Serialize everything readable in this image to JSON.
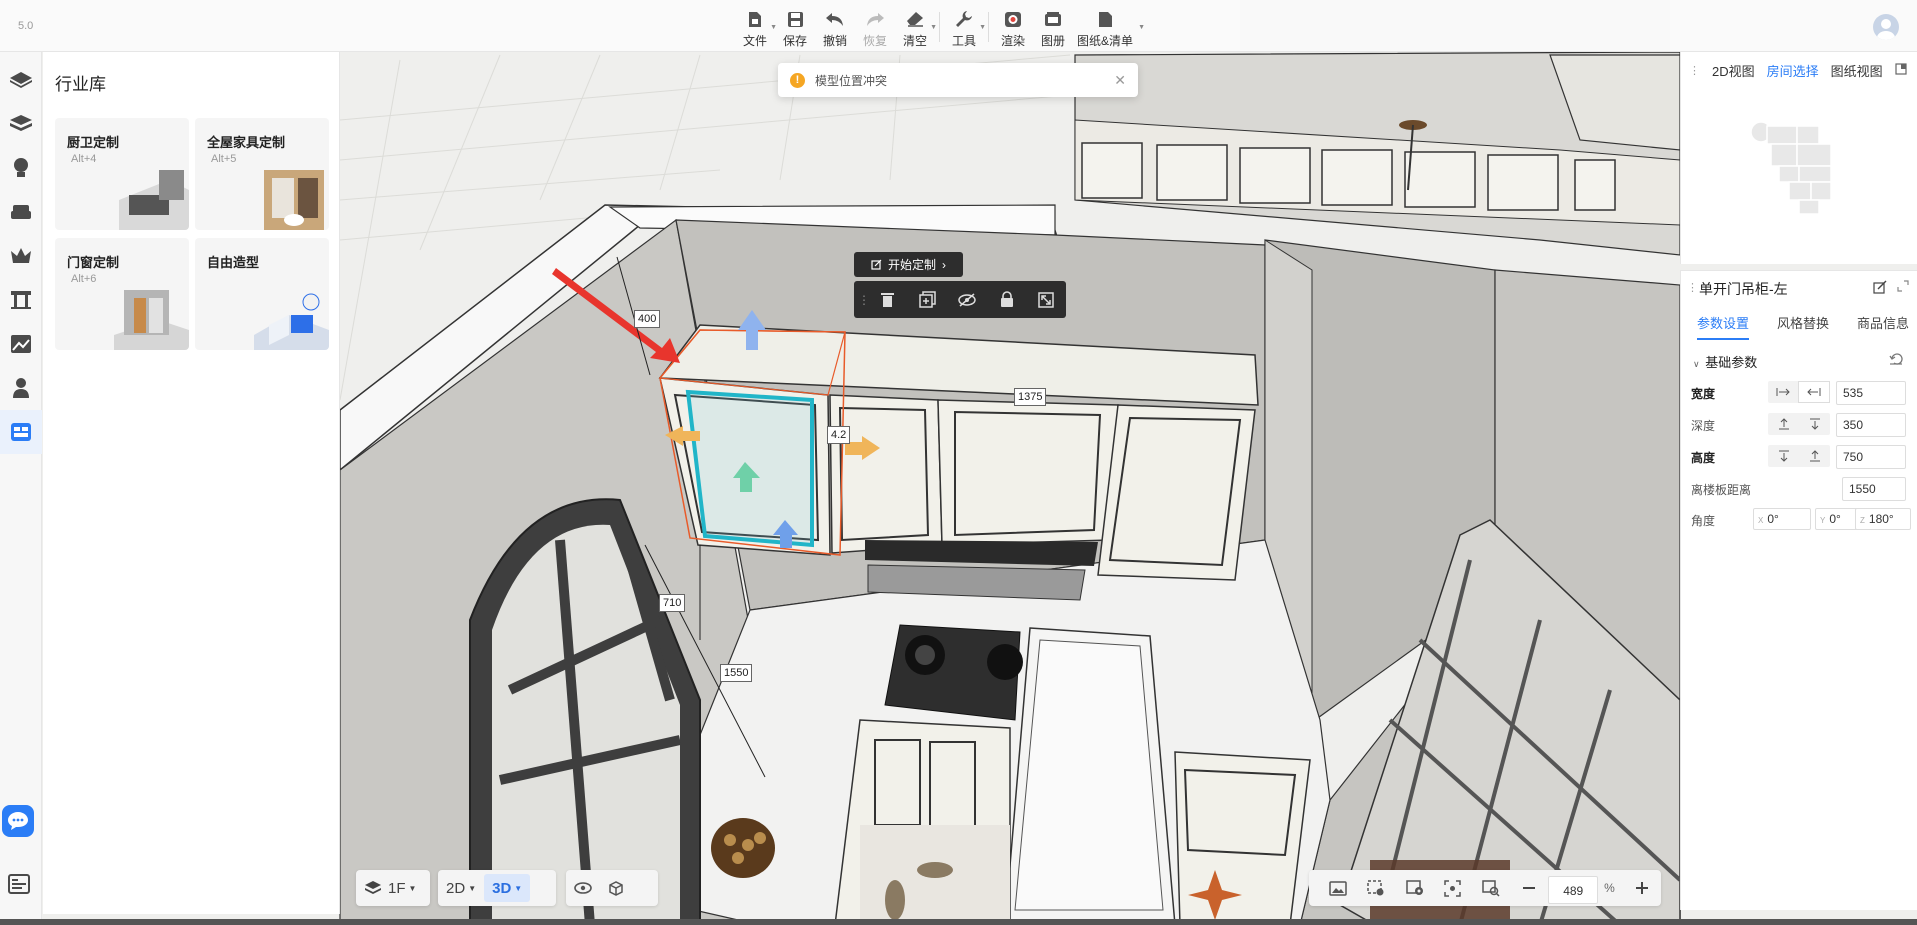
{
  "app": {
    "version": "5.0"
  },
  "toolbar": {
    "file": "文件",
    "save": "保存",
    "undo": "撤销",
    "redo": "恢复",
    "clear": "清空",
    "tools": "工具",
    "render": "渲染",
    "album": "图册",
    "drawings": "图纸&清单"
  },
  "toast": {
    "message": "模型位置冲突",
    "icon": "warning-icon"
  },
  "library": {
    "title": "行业库",
    "cards": [
      {
        "title": "厨卫定制",
        "shortcut": "Alt+4"
      },
      {
        "title": "全屋家具定制",
        "shortcut": "Alt+5"
      },
      {
        "title": "门窗定制",
        "shortcut": "Alt+6"
      },
      {
        "title": "自由造型",
        "shortcut": ""
      }
    ]
  },
  "object_toolbar": {
    "start_custom": "开始定制",
    "actions": [
      "delete-icon",
      "copy-icon",
      "hide-icon",
      "lock-icon",
      "fullscreen-icon"
    ]
  },
  "dimensions": {
    "d400": "400",
    "d1375": "1375",
    "d42": "4.2",
    "d710": "710",
    "d1550": "1550"
  },
  "bottom": {
    "floor": "1F",
    "view2d": "2D",
    "view3d": "3D",
    "zoom": "489",
    "percent": "%"
  },
  "right_top": {
    "tabs": [
      "2D视图",
      "房间选择",
      "图纸视图"
    ],
    "active_tab": "房间选择"
  },
  "properties": {
    "title": "单开门吊柜-左",
    "tabs": [
      "参数设置",
      "风格替换",
      "商品信息"
    ],
    "section": "基础参数",
    "width_label": "宽度",
    "width_value": "535",
    "depth_label": "深度",
    "depth_value": "350",
    "height_label": "高度",
    "height_value": "750",
    "floor_label": "离楼板距离",
    "floor_value": "1550",
    "angle_label": "角度",
    "angle_x": "0°",
    "angle_y": "0°",
    "angle_z": "180°",
    "ax_x": "X",
    "ax_y": "Y",
    "ax_z": "Z"
  },
  "colors": {
    "accent": "#2b7df6",
    "warning": "#f5a623",
    "selection": "#e85b2a",
    "highlight": "#21b5c8"
  }
}
